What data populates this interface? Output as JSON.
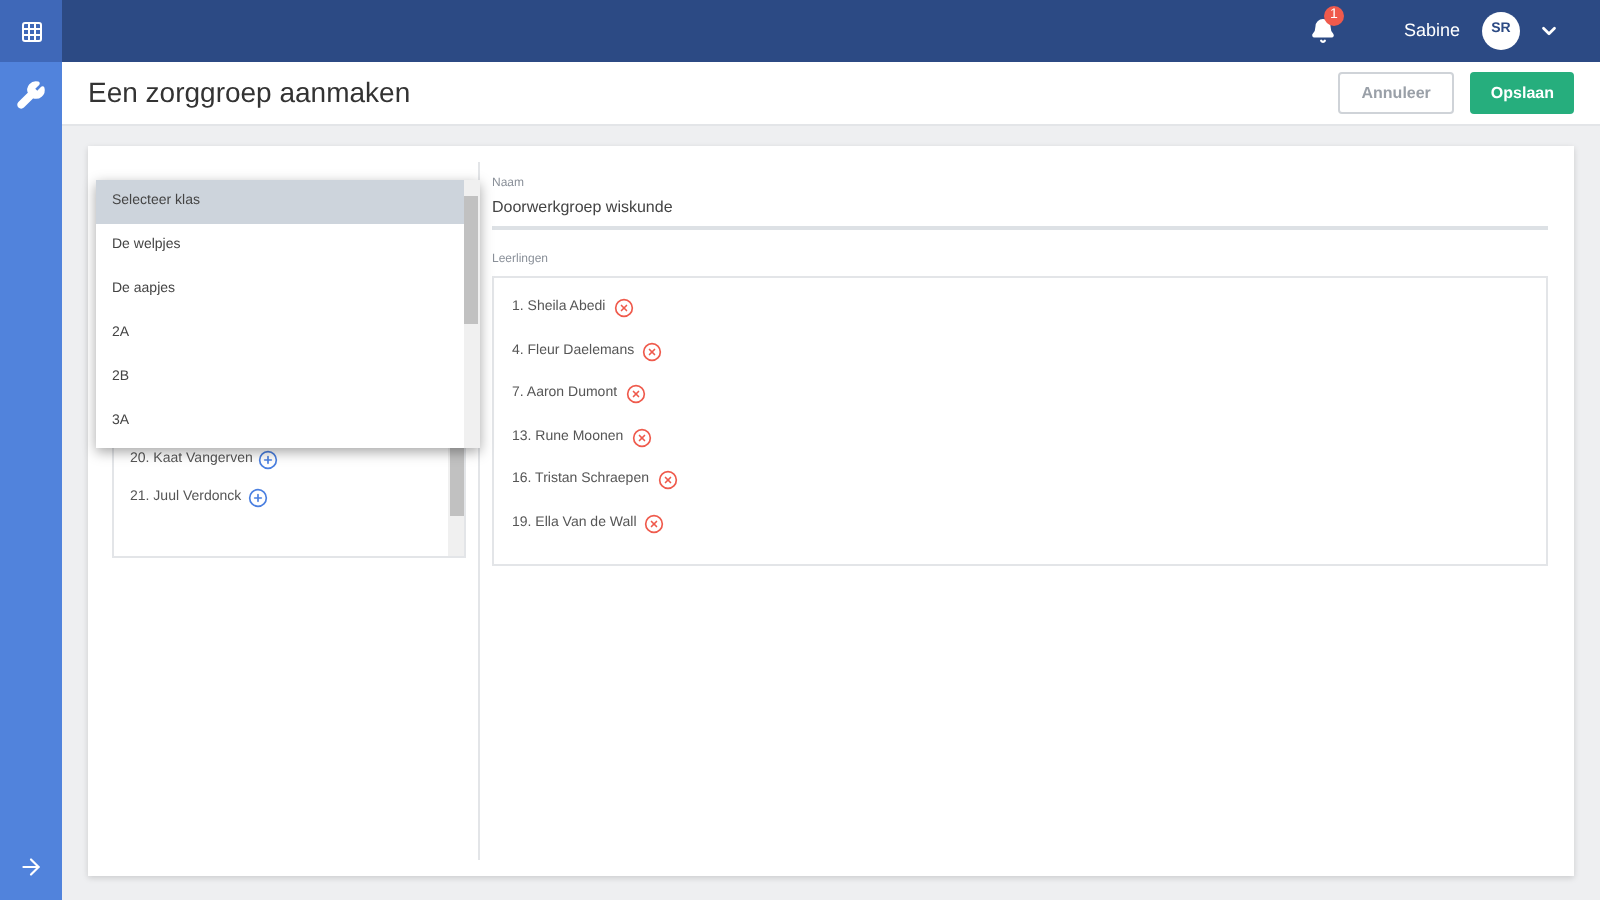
{
  "topbar": {
    "notifications": "1",
    "user_name": "Sabine",
    "avatar_initials": "SR"
  },
  "page": {
    "title": "Een zorggroep aanmaken",
    "buttons": [
      {
        "label": "Annuleer",
        "kind": "secondary"
      },
      {
        "label": "Opslaan",
        "kind": "primary"
      }
    ]
  },
  "class_dropdown": {
    "options": [
      {
        "label": "Selecteer klas",
        "selected": true
      },
      {
        "label": "De welpjes",
        "selected": false
      },
      {
        "label": "De aapjes",
        "selected": false
      },
      {
        "label": "2A",
        "selected": false
      },
      {
        "label": "2B",
        "selected": false
      },
      {
        "label": "3A",
        "selected": false
      }
    ]
  },
  "available_students": [
    "20. Kaat Vangerven",
    "21. Juul Verdonck"
  ],
  "form": {
    "name_label": "Naam",
    "name_value": "Doorwerkgroep wiskunde",
    "students_label": "Leerlingen",
    "students": [
      "1. Sheila Abedi",
      "4. Fleur Daelemans",
      "7. Aaron Dumont",
      "13. Rune Moonen",
      "16. Tristan Schraepen",
      "19. Ella Van de Wall"
    ]
  }
}
